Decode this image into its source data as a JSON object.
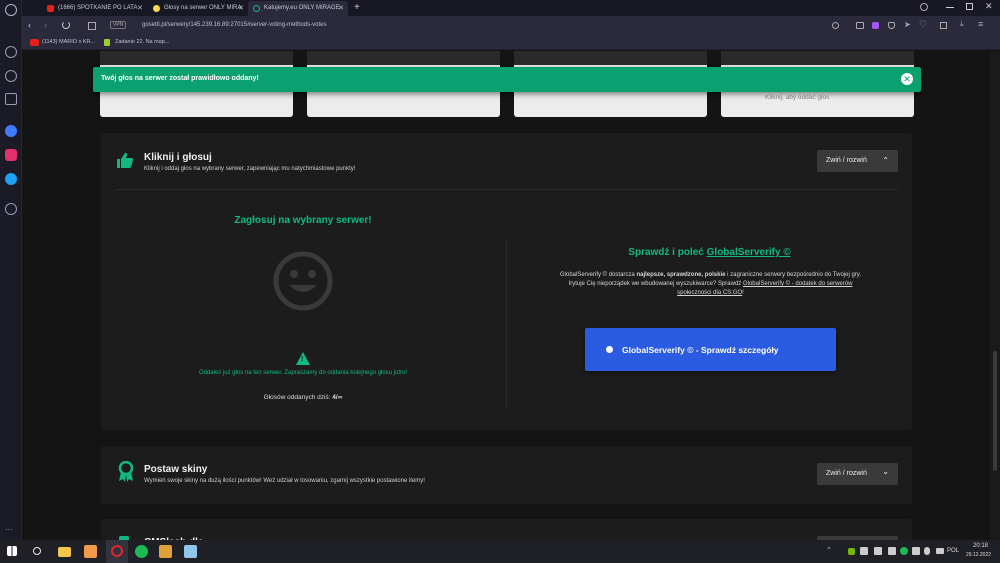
{
  "browser": {
    "tabs": [
      {
        "label": "(1666) SPOTKANIE PO LATA",
        "color": "#e62117"
      },
      {
        "label": "Głosy na serwer ONLY MIRA",
        "color": "#ffd84d"
      },
      {
        "label": "Katujemy.eu ONLY MIRAGE",
        "color": "#10b981"
      }
    ],
    "new_tab": "+",
    "vpn": "VPN",
    "url": "gosetti.pl/serwery/145.239.16.89:27015#server-voting-methods-votes",
    "bookmarks": [
      {
        "label": "(1143) MARIO x KR..."
      },
      {
        "label": "Zadanie 22. Na map..."
      }
    ]
  },
  "toast": {
    "message": "Twój głos na serwer został prawidłowo oddany!",
    "close": "✕"
  },
  "top_card_caption": "Kliknij, aby oddać głos",
  "vote_panel": {
    "title": "Kliknij i głosuj",
    "subtitle": "Kliknij i oddaj głos na wybrany serwer, zapewniając mu natychmiastowe punkty!",
    "toggle_label": "Zwiń / rozwiń",
    "toggle_chevron": "⌃",
    "left": {
      "heading": "Zagłosuj na wybrany serwer!",
      "warning_icon": "!",
      "notice": "Oddałeś już głos na ten serwer. Zapraszamy do oddania kolejnego głosu jutro!",
      "votes_label": "Głosów oddanych dziś:",
      "votes_value": "4/∞"
    },
    "right": {
      "heading_prefix": "Sprawdź i poleć",
      "heading_link": "GlobalServerify ©",
      "desc_1": "GlobalServerify © dostarcza",
      "desc_bold_1": "najlepsze, sprawdzone, polskie",
      "desc_2": "i zagraniczne serwery bezpośrednio do Twojej gry.",
      "desc_3": "Irytuje Cię nieporządek we wbudowanej wyszukiwarce? Sprawdź",
      "desc_link": "GlobalServerify © - dodatek do serwerów",
      "desc_link_2": "społeczności dla CS:GO",
      "desc_end": "!",
      "button_label": "GlobalServerify © - Sprawdź szczegóły"
    }
  },
  "skins_panel": {
    "title": "Postaw skiny",
    "subtitle": "Wymień swoje skiny na dużą ilości punktów! Weź udział w losowaniu, zgarnij wszystkie postawione itemy!",
    "toggle_label": "Zwiń / rozwiń",
    "toggle_chevron": "⌄"
  },
  "next_panel": {
    "title": "CMSlash dla ..."
  },
  "taskbar": {
    "lang": "POL",
    "time": "20:18",
    "date": "29.12.2022"
  },
  "colors": {
    "accent_green": "#10b981",
    "toast_green": "#0aa06f",
    "button_blue": "#2b5be0"
  }
}
